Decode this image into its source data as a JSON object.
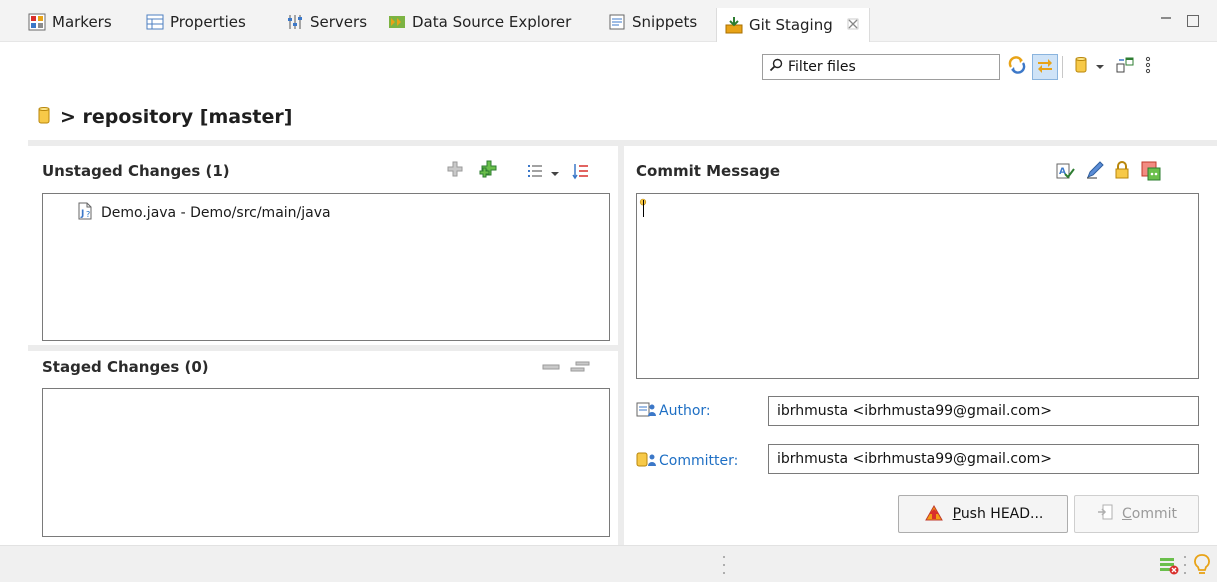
{
  "tabs": [
    {
      "label": "Markers",
      "icon": "markers-icon"
    },
    {
      "label": "Properties",
      "icon": "properties-icon"
    },
    {
      "label": "Servers",
      "icon": "servers-icon"
    },
    {
      "label": "Data Source Explorer",
      "icon": "data-source-icon"
    },
    {
      "label": "Snippets",
      "icon": "snippets-icon"
    },
    {
      "label": "Git Staging",
      "icon": "git-staging-icon",
      "active": true
    }
  ],
  "toolbar": {
    "filter_placeholder": "Filter files"
  },
  "repository": {
    "label": "> repository [master]"
  },
  "unstaged": {
    "title": "Unstaged Changes (1)",
    "files": [
      {
        "name": "Demo.java - Demo/src/main/java",
        "icon": "java-file-icon"
      }
    ]
  },
  "staged": {
    "title": "Staged Changes (0)",
    "files": []
  },
  "commit": {
    "title": "Commit Message",
    "message": "",
    "author_label": "Author:",
    "author_value": "ibrhmusta <ibrhmusta99@gmail.com>",
    "committer_label": "Committer:",
    "committer_value": "ibrhmusta <ibrhmusta99@gmail.com>",
    "push_label": "Push HEAD...",
    "push_mnemonic": "P",
    "push_rest": "ush HEAD...",
    "commit_label": "Commit",
    "commit_mnemonic": "C",
    "commit_rest": "ommit"
  },
  "colors": {
    "accent_blue": "#1e6fc4",
    "git_orange": "#e8a317",
    "selection": "#cfe3f7"
  }
}
